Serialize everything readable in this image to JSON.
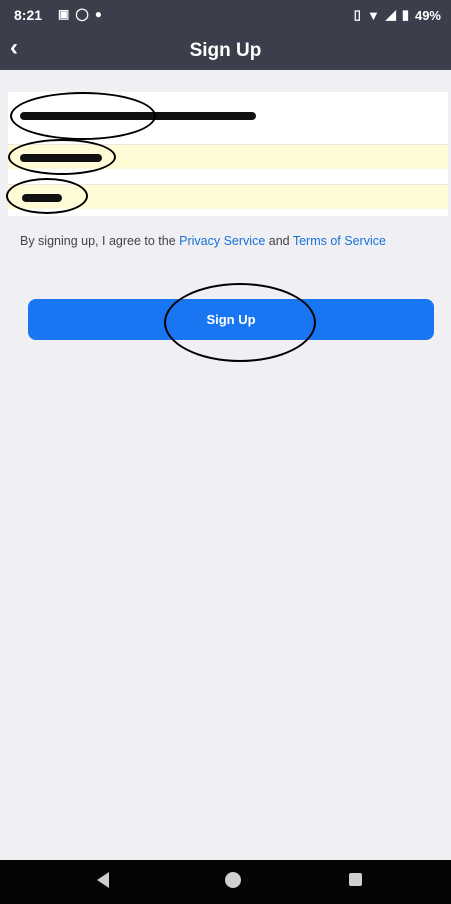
{
  "status_bar": {
    "time": "8:21",
    "battery": "49%",
    "left_icons": [
      "image-icon",
      "whatsapp-icon",
      "messenger-icon"
    ],
    "right_icons": [
      "vibrate-icon",
      "wifi-icon",
      "signal-icon",
      "battery-icon"
    ]
  },
  "app_bar": {
    "title": "Sign Up",
    "back_icon": "chevron-left-icon"
  },
  "form": {
    "fields": [
      {
        "name": "email",
        "value_redacted": true
      },
      {
        "name": "first-name",
        "value_redacted": true
      },
      {
        "name": "last-name",
        "value_redacted": true
      }
    ]
  },
  "terms": {
    "prefix": "By signing up, I agree to the ",
    "privacy_link": "Privacy Service",
    "middle": " and ",
    "terms_link": "Terms of Service"
  },
  "primary_button": {
    "label": "Sign Up"
  },
  "nav_bar": {
    "buttons": [
      "back-triangle-icon",
      "home-circle-icon",
      "recents-square-icon"
    ]
  },
  "colors": {
    "header_bg": "#3b3f4c",
    "button_bg": "#1976f2",
    "link": "#1672d8",
    "autofill_bg": "#fffbd6"
  }
}
